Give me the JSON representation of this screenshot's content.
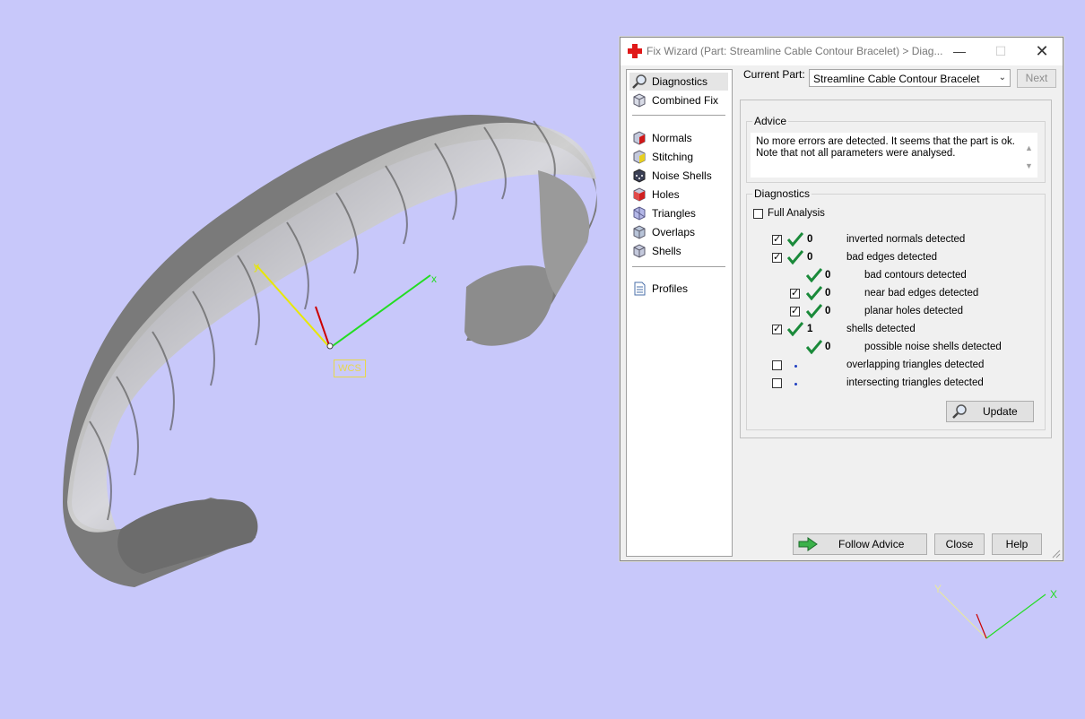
{
  "viewport": {
    "wcs_label": "WCS",
    "axis_x_label": "x",
    "axis_y_label": "y",
    "mini_axis_x_label": "X",
    "mini_axis_y_label": "Y",
    "background_color": "#c8c8fa"
  },
  "window": {
    "title": "Fix Wizard (Part: Streamline Cable Contour Bracelet) > Diag...",
    "title_icon": "red-cross-icon",
    "controls": [
      "minimize",
      "maximize",
      "close"
    ]
  },
  "nav": {
    "items": [
      {
        "label": "Diagnostics",
        "icon": "magnifier-icon",
        "selected": true
      },
      {
        "label": "Combined Fix",
        "icon": "cube-icon"
      },
      {
        "label": "Normals",
        "icon": "cube-red-face-icon"
      },
      {
        "label": "Stitching",
        "icon": "cube-yellow-icon"
      },
      {
        "label": "Noise Shells",
        "icon": "cube-dots-icon"
      },
      {
        "label": "Holes",
        "icon": "cube-holes-icon"
      },
      {
        "label": "Triangles",
        "icon": "cube-triangles-icon"
      },
      {
        "label": "Overlaps",
        "icon": "cube-overlaps-icon"
      },
      {
        "label": "Shells",
        "icon": "cube-shells-icon"
      },
      {
        "label": "Profiles",
        "icon": "document-icon"
      }
    ]
  },
  "current_part": {
    "label": "Current Part:",
    "value": "Streamline Cable Contour Bracelet",
    "next_label": "Next"
  },
  "advice": {
    "title": "Advice",
    "line1": "No more errors are detected. It seems that the part is ok.",
    "line2": "Note that not all parameters were analysed."
  },
  "diagnostics": {
    "title": "Diagnostics",
    "full_analysis_label": "Full Analysis",
    "full_analysis_checked": false,
    "rows": [
      {
        "checked": true,
        "status": "ok",
        "count": "0",
        "label": "inverted normals detected"
      },
      {
        "checked": true,
        "status": "ok",
        "count": "0",
        "label": "bad edges detected"
      },
      {
        "checkbox": false,
        "status": "ok",
        "count": "0",
        "label": "bad contours detected"
      },
      {
        "checked": true,
        "status": "ok",
        "count": "0",
        "label": "near bad edges detected"
      },
      {
        "checked": true,
        "status": "ok",
        "count": "0",
        "label": "planar holes detected"
      },
      {
        "checked": true,
        "status": "ok",
        "count": "1",
        "label": "shells detected"
      },
      {
        "checkbox": false,
        "status": "ok",
        "count": "0",
        "label": "possible noise shells detected"
      },
      {
        "checked": false,
        "status": "not-analysed",
        "count": "",
        "label": "overlapping triangles detected"
      },
      {
        "checked": false,
        "status": "not-analysed",
        "count": "",
        "label": "intersecting triangles detected"
      }
    ],
    "update_label": "Update"
  },
  "footer": {
    "follow_advice_label": "Follow Advice",
    "close_label": "Close",
    "help_label": "Help"
  }
}
